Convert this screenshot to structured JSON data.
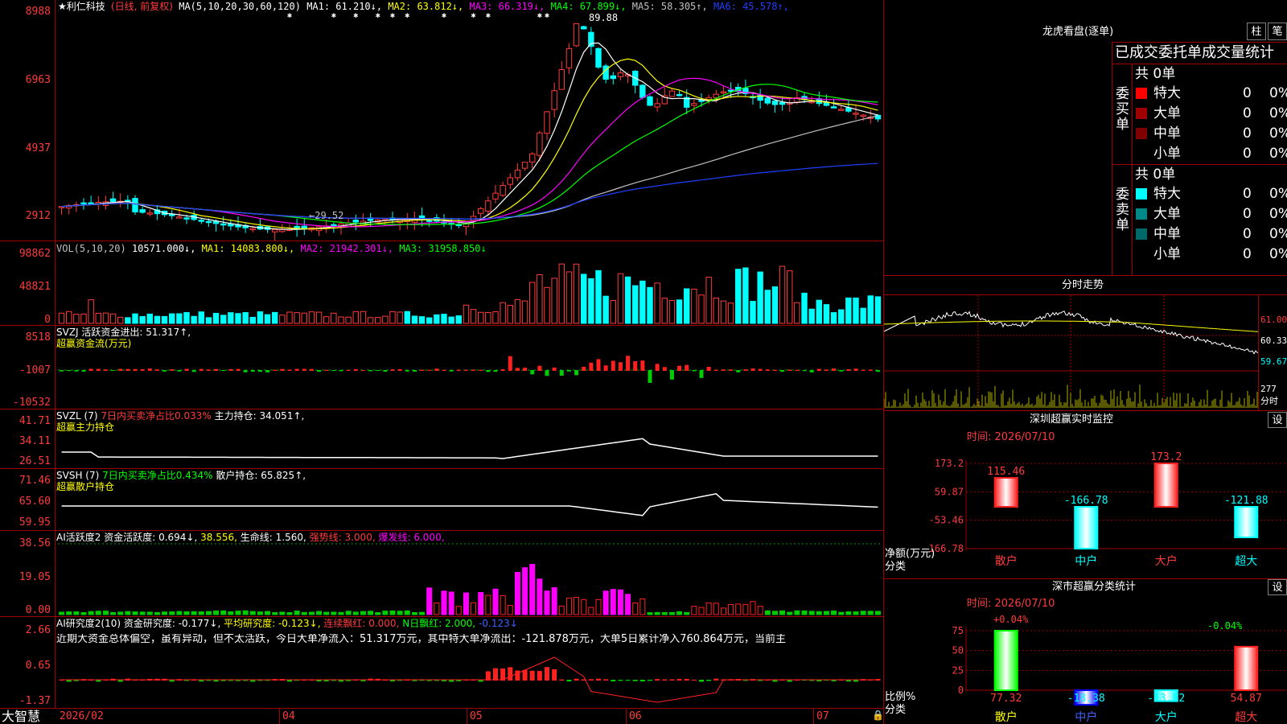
{
  "main": {
    "ylabels": [
      "8988",
      "6963",
      "4937",
      "2912"
    ],
    "title_star": "★利仁科技",
    "mode": "(日线, 前复权)",
    "ma_prefix": "MA(5,10,20,30,60,120)",
    "ma": [
      {
        "label": "MA1: 61.210↓",
        "color": "#ffffff"
      },
      {
        "label": "MA2: 63.812↓",
        "color": "#ffff00"
      },
      {
        "label": "MA3: 66.319↓",
        "color": "#ff00ff"
      },
      {
        "label": "MA4: 67.899↓",
        "color": "#00ff00"
      },
      {
        "label": "MA5: 58.305↑",
        "color": "#c0c0c0"
      },
      {
        "label": "MA6: 45.578↑",
        "color": "#2040ff"
      }
    ],
    "high_mark": "89.88",
    "low_mark": "←29.52"
  },
  "vol": {
    "header": "VOL(5,10,20)",
    "value": "10571.000↓",
    "ma1": "MA1: 14083.800↓",
    "ma2": "MA2: 21942.301↓",
    "ma3": "MA3: 31958.850↓",
    "ylabels": [
      "98862",
      "48821",
      "0"
    ]
  },
  "svzj": {
    "header": "SVZJ  活跃资金进出: 51.317↑,",
    "sub": "超赢资金流(万元)",
    "ylabels": [
      "8518",
      "-1007",
      "-10532"
    ]
  },
  "svzl": {
    "header_a": "SVZL (7)",
    "header_b": "7日内买卖净占比0.033%",
    "header_c": "主力持仓: 34.051↑,",
    "sub": "超赢主力持仓",
    "ylabels": [
      "41.71",
      "34.11",
      "26.51"
    ]
  },
  "svsh": {
    "header_a": "SVSH (7)",
    "header_b": "7日内买卖净占比0.434%",
    "header_c": "散户持仓: 65.825↑,",
    "sub": "超赢散户持仓",
    "ylabels": [
      "71.46",
      "65.60",
      "59.95"
    ]
  },
  "ai1": {
    "h1": "AI活跃度2",
    "h2": "资金活跃度: 0.694↓,",
    "h3": "38.556,",
    "h4": "生命线: 1.560,",
    "h5": "强势线: 3.000,",
    "h6": "爆发线: 6.000,",
    "ylabels": [
      "38.56",
      "19.05",
      "0.00"
    ]
  },
  "ai2": {
    "h1": "AI研究度2(10)",
    "h2": "资金研究度: -0.177↓,",
    "h3": "平均研究度: -0.123↓,",
    "h4": "连续飘红: 0.000,",
    "h5": "N日飘红: 2.000,",
    "h6": "-0.123↓",
    "comment": "近期大资金总体偏空，虽有异动，但不太活跃，今日大单净流入：51.317万元，其中特大单净流出：-121.878万元，大单5日累计净入760.864万元，当前主",
    "ylabels": [
      "2.66",
      "0.65",
      "-1.37"
    ]
  },
  "xaxis": {
    "brand": "大智慧",
    "labels": [
      "2026/02",
      "04",
      "05",
      "06",
      "07"
    ]
  },
  "lhb": {
    "title": "龙虎看盘(逐单)",
    "btn1": "柱",
    "btn2": "笔",
    "subtitle": "已成交委托单成交量统计",
    "buy_label": "委买单",
    "sell_label": "委卖单",
    "total": "共 0单",
    "buy": [
      {
        "name": "特大",
        "n": "0",
        "p": "0%",
        "color": "#ff0000"
      },
      {
        "name": "大单",
        "n": "0",
        "p": "0%",
        "color": "#a00000"
      },
      {
        "name": "中单",
        "n": "0",
        "p": "0%",
        "color": "#800000"
      },
      {
        "name": "小单",
        "n": "0",
        "p": "0%",
        "color": "#000000"
      }
    ],
    "sell": [
      {
        "name": "特大",
        "n": "0",
        "p": "0%",
        "color": "#00ffff"
      },
      {
        "name": "大单",
        "n": "0",
        "p": "0%",
        "color": "#008888"
      },
      {
        "name": "中单",
        "n": "0",
        "p": "0%",
        "color": "#006868"
      },
      {
        "name": "小单",
        "n": "0",
        "p": "0%",
        "color": "#000000"
      }
    ]
  },
  "fenshi": {
    "title": "分时走势",
    "ylabels": [
      "61.00",
      "60.33",
      "59.67"
    ],
    "vol_label": "277",
    "vol_unit": "分时"
  },
  "monitor": {
    "title": "深圳超赢实时监控",
    "btn": "设",
    "time": "时间: 2026/07/10",
    "ylabels": [
      "173.2",
      "59.87",
      "-53.46",
      "-166.78"
    ],
    "unit": "净额(万元)",
    "cat": "分类",
    "chart_data": {
      "type": "bar",
      "categories": [
        "散户",
        "中户",
        "大户",
        "超大"
      ],
      "values": [
        115.46,
        -166.78,
        173.2,
        -121.88
      ],
      "ylim": [
        -166.78,
        173.2
      ]
    }
  },
  "classstat": {
    "title": "深市超赢分类统计",
    "btn": "设",
    "time": "时间: 2026/07/10",
    "ylabels": [
      "75",
      "50",
      "25",
      "0"
    ],
    "unit": "比例%",
    "cat": "分类",
    "top_left": "+0.04%",
    "top_right": "-0.04%",
    "chart_data": {
      "type": "bar",
      "categories": [
        "散户",
        "中户",
        "大户",
        "超大"
      ],
      "values": [
        77.32,
        -18.38,
        -13.82,
        54.87
      ],
      "ylim": [
        0,
        75
      ]
    }
  }
}
